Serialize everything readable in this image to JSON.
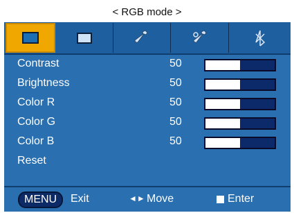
{
  "window": {
    "title": "< RGB mode >"
  },
  "tabs": [
    {
      "icon": "screen-picture-icon",
      "active": true
    },
    {
      "icon": "screen-small-icon",
      "active": false
    },
    {
      "icon": "wrench-icon",
      "active": false
    },
    {
      "icon": "wrench-settings-icon",
      "active": false
    },
    {
      "icon": "network-icon",
      "active": false
    }
  ],
  "settings": [
    {
      "label": "Contrast",
      "value": "50",
      "level": 0.5
    },
    {
      "label": "Brightness",
      "value": "50",
      "level": 0.5
    },
    {
      "label": "Color R",
      "value": "50",
      "level": 0.5
    },
    {
      "label": "Color G",
      "value": "50",
      "level": 0.5
    },
    {
      "label": "Color B",
      "value": "50",
      "level": 0.5
    },
    {
      "label": "Reset"
    }
  ],
  "footer": {
    "menu_key": "MENU",
    "exit_label": "Exit",
    "move_arrows": "◄►",
    "move_label": "Move",
    "enter_label": "Enter"
  },
  "colors": {
    "panel": "#2a6faf",
    "active_tab": "#f0a800",
    "bar_track": "#0c2a6a",
    "bar_fill": "#ffffff"
  }
}
